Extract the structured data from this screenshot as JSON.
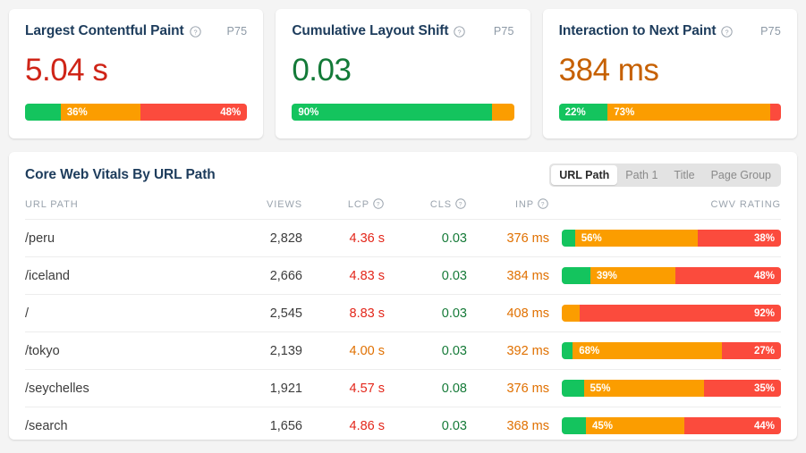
{
  "colors": {
    "good": "#14c45e",
    "needs_improvement": "#fb9d00",
    "poor": "#fb4b3d",
    "title": "#1d3c5c",
    "background": "#f4f4f4"
  },
  "metric_cards": [
    {
      "title": "Largest Contentful Paint",
      "percentile_label": "P75",
      "value": "5.04 s",
      "value_state": "poor",
      "distribution": [
        {
          "rating": "good",
          "percent": 16,
          "label": ""
        },
        {
          "rating": "needs_improvement",
          "percent": 36,
          "label": "36%"
        },
        {
          "rating": "poor",
          "percent": 48,
          "label": "48%"
        }
      ]
    },
    {
      "title": "Cumulative Layout Shift",
      "percentile_label": "P75",
      "value": "0.03",
      "value_state": "good",
      "distribution": [
        {
          "rating": "good",
          "percent": 90,
          "label": "90%"
        },
        {
          "rating": "needs_improvement",
          "percent": 10,
          "label": ""
        }
      ]
    },
    {
      "title": "Interaction to Next Paint",
      "percentile_label": "P75",
      "value": "384 ms",
      "value_state": "needs_improvement",
      "distribution": [
        {
          "rating": "good",
          "percent": 22,
          "label": "22%"
        },
        {
          "rating": "needs_improvement",
          "percent": 73,
          "label": "73%"
        },
        {
          "rating": "poor",
          "percent": 5,
          "label": ""
        }
      ]
    }
  ],
  "table": {
    "title": "Core Web Vitals By URL Path",
    "segmented_control": {
      "options": [
        "URL Path",
        "Path 1",
        "Title",
        "Page Group"
      ],
      "selected": "URL Path"
    },
    "columns": {
      "path": "URL PATH",
      "views": "VIEWS",
      "lcp": "LCP",
      "cls": "CLS",
      "inp": "INP",
      "rating": "CWV RATING"
    },
    "rows": [
      {
        "path": "/peru",
        "views": "2,828",
        "lcp": "4.36 s",
        "lcp_state": "poor",
        "cls": "0.03",
        "cls_state": "good",
        "inp": "376 ms",
        "inp_state": "needs_improvement",
        "distribution": [
          {
            "rating": "good",
            "percent": 6,
            "label": ""
          },
          {
            "rating": "needs_improvement",
            "percent": 56,
            "label": "56%"
          },
          {
            "rating": "poor",
            "percent": 38,
            "label": "38%"
          }
        ]
      },
      {
        "path": "/iceland",
        "views": "2,666",
        "lcp": "4.83 s",
        "lcp_state": "poor",
        "cls": "0.03",
        "cls_state": "good",
        "inp": "384 ms",
        "inp_state": "needs_improvement",
        "distribution": [
          {
            "rating": "good",
            "percent": 13,
            "label": ""
          },
          {
            "rating": "needs_improvement",
            "percent": 39,
            "label": "39%"
          },
          {
            "rating": "poor",
            "percent": 48,
            "label": "48%"
          }
        ]
      },
      {
        "path": "/",
        "views": "2,545",
        "lcp": "8.83 s",
        "lcp_state": "poor",
        "cls": "0.03",
        "cls_state": "good",
        "inp": "408 ms",
        "inp_state": "needs_improvement",
        "distribution": [
          {
            "rating": "needs_improvement",
            "percent": 8,
            "label": ""
          },
          {
            "rating": "poor",
            "percent": 92,
            "label": "92%"
          }
        ]
      },
      {
        "path": "/tokyo",
        "views": "2,139",
        "lcp": "4.00 s",
        "lcp_state": "needs_improvement",
        "cls": "0.03",
        "cls_state": "good",
        "inp": "392 ms",
        "inp_state": "needs_improvement",
        "distribution": [
          {
            "rating": "good",
            "percent": 5,
            "label": ""
          },
          {
            "rating": "needs_improvement",
            "percent": 68,
            "label": "68%"
          },
          {
            "rating": "poor",
            "percent": 27,
            "label": "27%"
          }
        ]
      },
      {
        "path": "/seychelles",
        "views": "1,921",
        "lcp": "4.57 s",
        "lcp_state": "poor",
        "cls": "0.08",
        "cls_state": "good",
        "inp": "376 ms",
        "inp_state": "needs_improvement",
        "distribution": [
          {
            "rating": "good",
            "percent": 10,
            "label": ""
          },
          {
            "rating": "needs_improvement",
            "percent": 55,
            "label": "55%"
          },
          {
            "rating": "poor",
            "percent": 35,
            "label": "35%"
          }
        ]
      },
      {
        "path": "/search",
        "views": "1,656",
        "lcp": "4.86 s",
        "lcp_state": "poor",
        "cls": "0.03",
        "cls_state": "good",
        "inp": "368 ms",
        "inp_state": "needs_improvement",
        "distribution": [
          {
            "rating": "good",
            "percent": 11,
            "label": ""
          },
          {
            "rating": "needs_improvement",
            "percent": 45,
            "label": "45%"
          },
          {
            "rating": "poor",
            "percent": 44,
            "label": "44%"
          }
        ]
      }
    ]
  }
}
